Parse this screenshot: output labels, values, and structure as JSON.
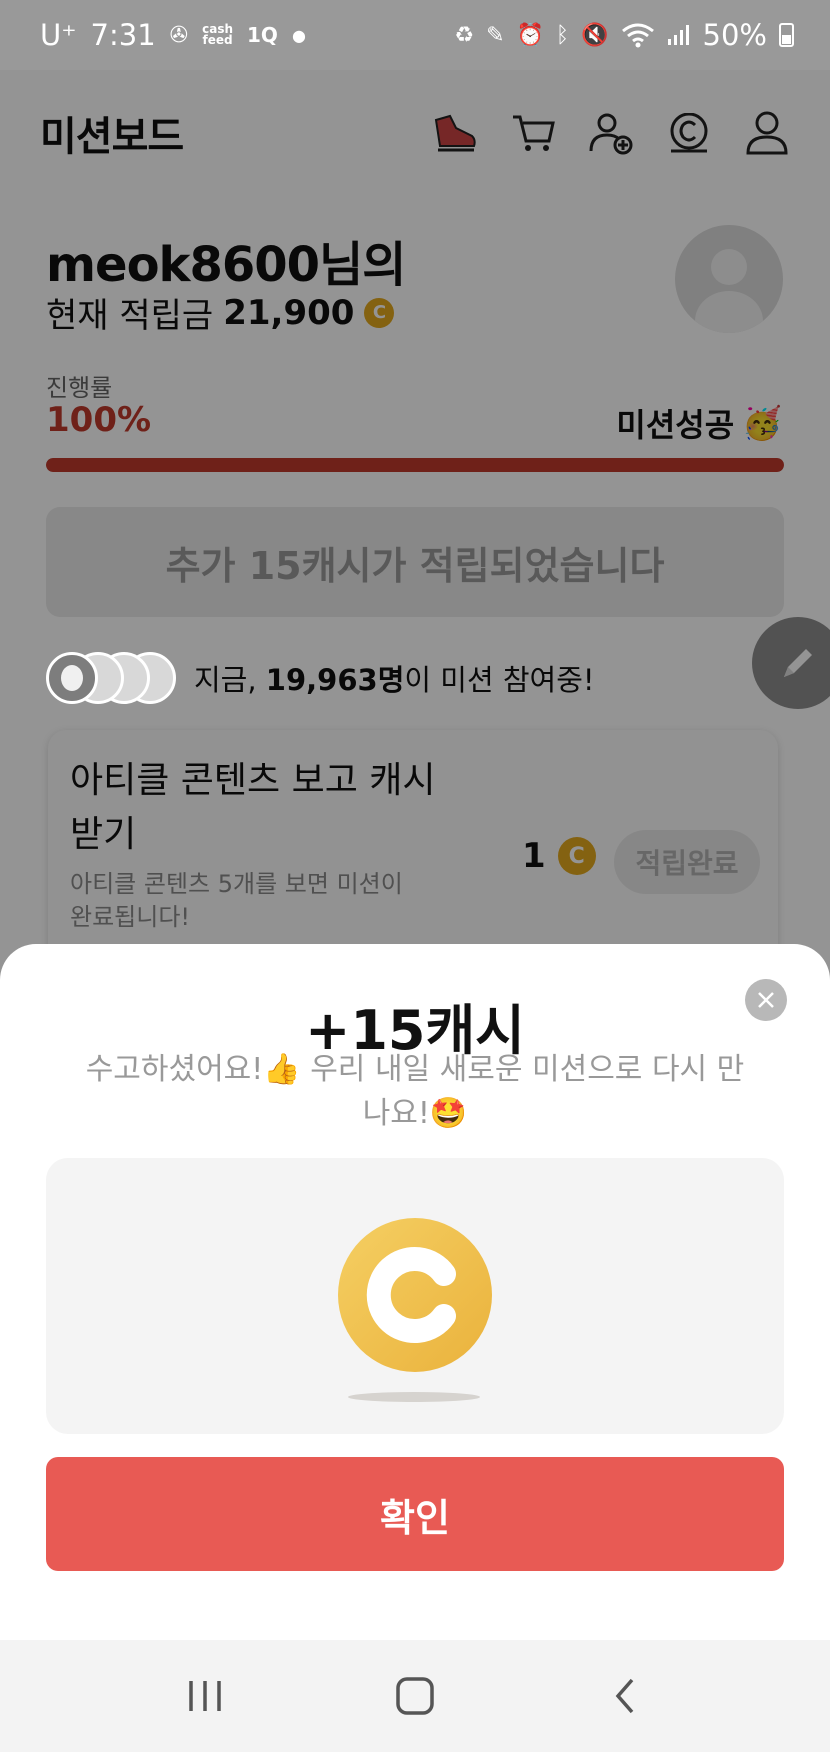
{
  "status_bar": {
    "carrier": "U⁺",
    "time": "7:31",
    "cashfeed_label": "cash\nfeed",
    "tq_label": "1Q",
    "battery": "50%"
  },
  "app": {
    "title": "미션보드",
    "user_name": "meok8600님의",
    "balance_label": "현재 적립금",
    "balance_amount": "21,900",
    "coin_symbol": "C",
    "progress_label": "진행률",
    "progress_value": "100%",
    "progress_fraction": 1.0,
    "mission_status": "미션성공",
    "mission_status_emoji": "🥳",
    "extra_banner": "추가 15캐시가 적립되었습니다",
    "participants_prefix": "지금, ",
    "participants_count": "19,963명",
    "participants_suffix": "이 미션 참여중!",
    "mission_card": {
      "title": "아티클 콘텐츠 보고 캐시 받기",
      "description": "아티클 콘텐츠 5개를 보면 미션이 완료됩니다!",
      "reward": "1",
      "button_label": "적립완료"
    }
  },
  "sheet": {
    "title": "+15캐시",
    "message": "수고하셨어요!👍 우리 내일 새로운 미션으로 다시 만나요!🤩",
    "confirm_label": "확인"
  },
  "colors": {
    "accent": "#e85a54",
    "progress": "#c0392b",
    "coin": "#eab23c"
  }
}
